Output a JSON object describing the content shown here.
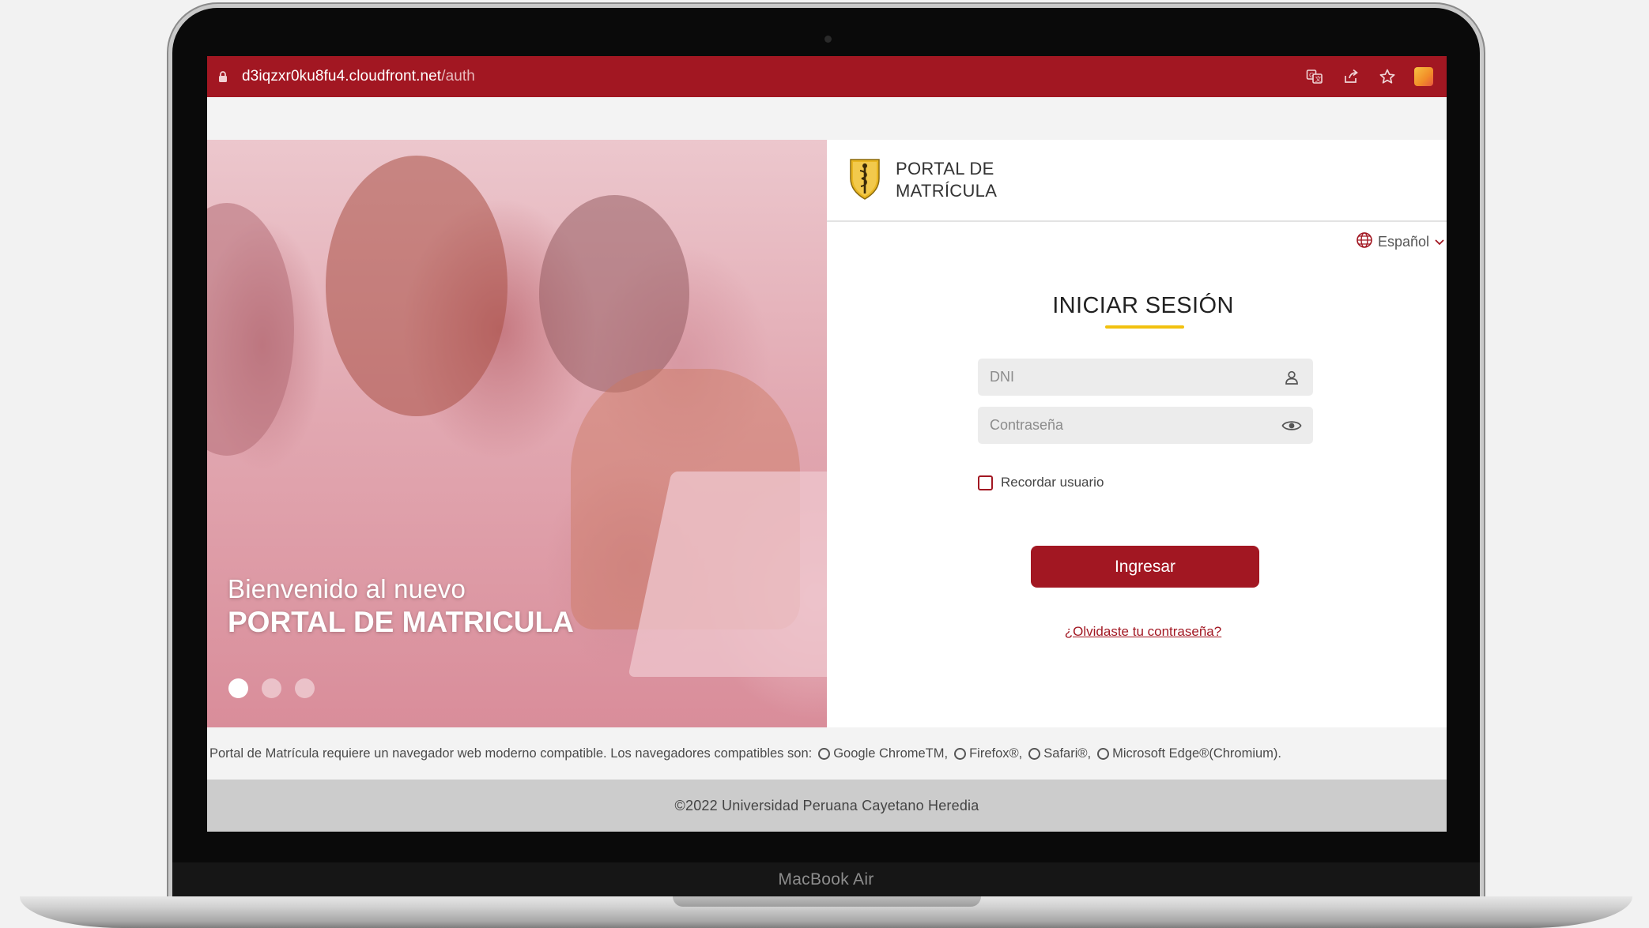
{
  "device": {
    "label": "MacBook Air"
  },
  "browser": {
    "url_host": "d3iqzxr0ku8fu4.cloudfront.net",
    "url_path": "/auth",
    "icons": [
      "translate-icon",
      "share-icon",
      "star-icon",
      "extension-icon"
    ]
  },
  "hero": {
    "welcome": "Bienvenido al nuevo",
    "headline": "PORTAL DE MATRICULA",
    "slides": 3,
    "active_slide": 1
  },
  "brand": {
    "line1": "PORTAL DE",
    "line2": "MATRÍCULA"
  },
  "language": {
    "selected": "Español"
  },
  "login": {
    "title": "INICIAR SESIÓN",
    "dni_placeholder": "DNI",
    "password_placeholder": "Contraseña",
    "remember_label": "Recordar usuario",
    "submit_label": "Ingresar",
    "forgot_label": "¿Olvidaste tu contraseña?"
  },
  "footer": {
    "compat_text": "Portal de Matrícula requiere un navegador web moderno compatible. Los navegadores compatibles son:",
    "browsers": [
      "Google ChromeTM,",
      "Firefox®,",
      "Safari®,",
      "Microsoft Edge®(Chromium)."
    ],
    "copyright": "©2022 Universidad Peruana Cayetano Heredia"
  },
  "colors": {
    "primary": "#a21722",
    "accent": "#f2c10f",
    "field_bg": "#ececec"
  }
}
